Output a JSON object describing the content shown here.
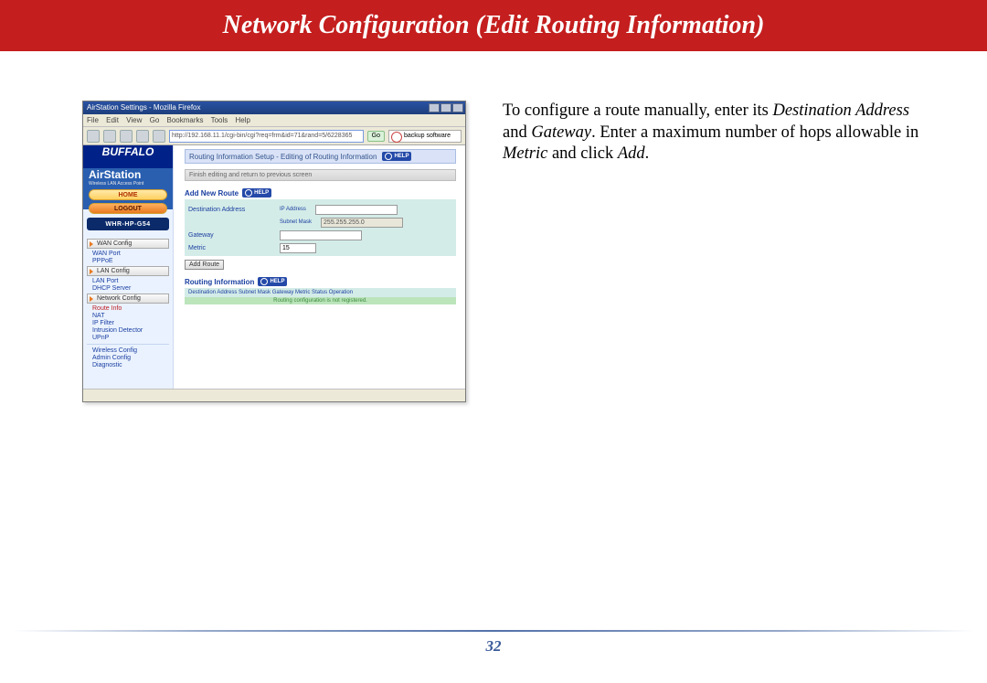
{
  "page": {
    "title": "Network Configuration (Edit Routing Information)",
    "number": "32"
  },
  "desc": {
    "s1a": "To configure a route manually, enter its ",
    "s1b": "Destination Address",
    "s1c": " and ",
    "s1d": "Gateway",
    "s1e": ".  Enter a maximum number of hops allowable in ",
    "s1f": "Metric",
    "s1g": " and click ",
    "s1h": "Add",
    "s1i": "."
  },
  "browser": {
    "window_title": "AirStation Settings - Mozilla Firefox",
    "menus": [
      "File",
      "Edit",
      "View",
      "Go",
      "Bookmarks",
      "Tools",
      "Help"
    ],
    "url": "http://192.168.11.1/cgi-bin/cgi?req=frm&id=71&rand=5/6228365",
    "go_label": "Go",
    "search_placeholder": "backup software"
  },
  "sidebar": {
    "brand_top": "BUFFALO",
    "brand_main": "AirStation",
    "brand_sub": "Wireless LAN Access Point",
    "home": "HOME",
    "logout": "LOGOUT",
    "model": "WHR-HP-G54",
    "items": [
      {
        "type": "btn",
        "label": "WAN Config"
      },
      {
        "type": "link",
        "label": "WAN Port"
      },
      {
        "type": "link",
        "label": "PPPoE"
      },
      {
        "type": "btn",
        "label": "LAN Config"
      },
      {
        "type": "link",
        "label": "LAN Port"
      },
      {
        "type": "link",
        "label": "DHCP Server"
      },
      {
        "type": "btn",
        "label": "Network Config"
      },
      {
        "type": "link-red",
        "label": "Route Info"
      },
      {
        "type": "link",
        "label": "NAT"
      },
      {
        "type": "link",
        "label": "IP Filter"
      },
      {
        "type": "link",
        "label": "Intrusion Detector"
      },
      {
        "type": "link",
        "label": "UPnP"
      },
      {
        "type": "sep"
      },
      {
        "type": "link",
        "label": "Wireless Config"
      },
      {
        "type": "link",
        "label": "Admin Config"
      },
      {
        "type": "link",
        "label": "Diagnostic"
      }
    ]
  },
  "main": {
    "panel_title": "Routing Information Setup - Editing of Routing Information",
    "help": "HELP",
    "finish_bar": "Finish editing and return to previous screen",
    "add_section": "Add New Route",
    "labels": {
      "dest": "Destination Address",
      "ip": "IP Address",
      "mask": "Subnet Mask",
      "gateway": "Gateway",
      "metric": "Metric"
    },
    "values": {
      "mask": "255.255.255.0",
      "metric": "15"
    },
    "add_button": "Add Route",
    "ri_section": "Routing Information",
    "ri_columns": "Destination Address Subnet Mask Gateway Metric Status Operation",
    "ri_empty": "Routing configuration is not registered."
  }
}
